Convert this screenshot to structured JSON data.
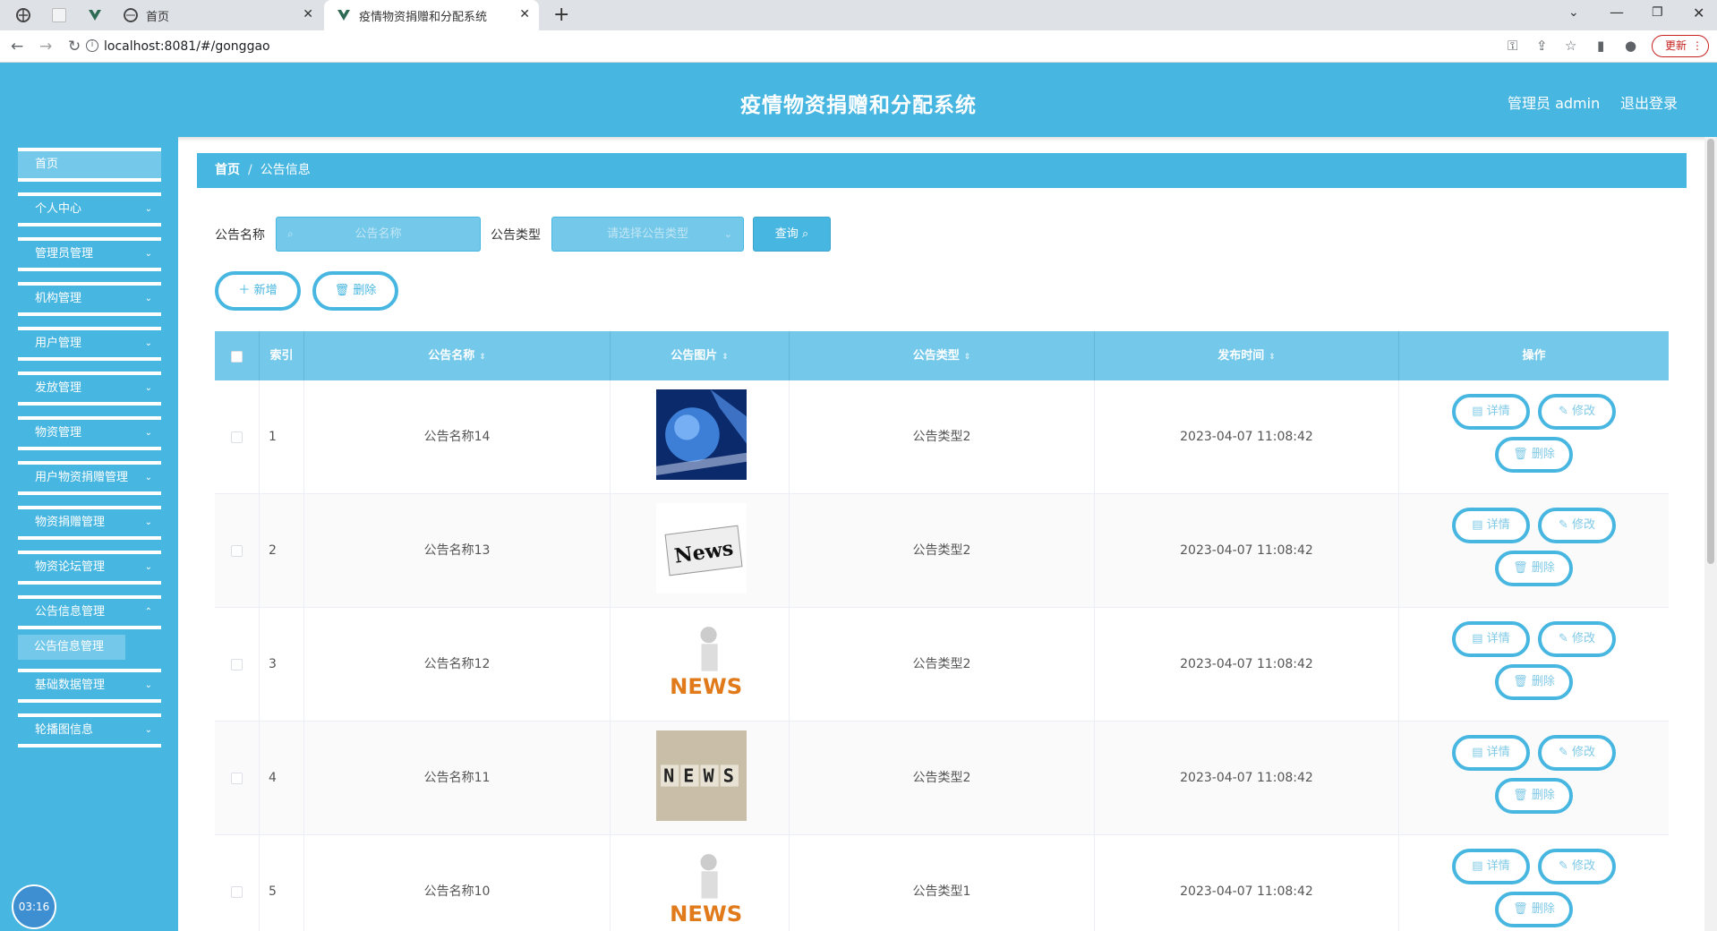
{
  "browser": {
    "tabs": [
      {
        "title": "首页"
      },
      {
        "title": "疫情物资捐赠和分配系统"
      }
    ],
    "new_tab": "+",
    "url": "localhost:8081/#/gonggao",
    "update_label": "更新"
  },
  "app": {
    "title": "疫情物资捐赠和分配系统",
    "user": "管理员 admin",
    "logout": "退出登录"
  },
  "sidebar": {
    "items": [
      {
        "label": "首页"
      },
      {
        "label": "个人中心"
      },
      {
        "label": "管理员管理"
      },
      {
        "label": "机构管理"
      },
      {
        "label": "用户管理"
      },
      {
        "label": "发放管理"
      },
      {
        "label": "物资管理"
      },
      {
        "label": "用户物资捐赠管理"
      },
      {
        "label": "物资捐赠管理"
      },
      {
        "label": "物资论坛管理"
      },
      {
        "label": "公告信息管理"
      },
      {
        "label": "基础数据管理"
      },
      {
        "label": "轮播图信息"
      }
    ],
    "submenu": "公告信息管理",
    "clock": "03:16"
  },
  "breadcrumb": {
    "home": "首页",
    "sep": "/",
    "current": "公告信息"
  },
  "search": {
    "name_label": "公告名称",
    "name_placeholder": "公告名称",
    "type_label": "公告类型",
    "type_placeholder": "请选择公告类型",
    "query_label": "查询"
  },
  "actions": {
    "add": "新增",
    "delete": "删除"
  },
  "table": {
    "headers": [
      "索引",
      "公告名称",
      "公告图片",
      "公告类型",
      "发布时间",
      "操作"
    ],
    "rows": [
      {
        "index": "1",
        "name": "公告名称14",
        "image": "globe-image",
        "type": "公告类型2",
        "time": "2023-04-07 11:08:42"
      },
      {
        "index": "2",
        "name": "公告名称13",
        "image": "news-paper-image",
        "type": "公告类型2",
        "time": "2023-04-07 11:08:42"
      },
      {
        "index": "3",
        "name": "公告名称12",
        "image": "news-figure-image",
        "type": "公告类型2",
        "time": "2023-04-07 11:08:42"
      },
      {
        "index": "4",
        "name": "公告名称11",
        "image": "news-blocks-image",
        "type": "公告类型2",
        "time": "2023-04-07 11:08:42"
      },
      {
        "index": "5",
        "name": "公告名称10",
        "image": "news-figure-image",
        "type": "公告类型1",
        "time": "2023-04-07 11:08:42"
      }
    ],
    "op_labels": {
      "detail": "详情",
      "edit": "修改",
      "delete": "删除"
    }
  },
  "colors": {
    "primary": "#47b6e0",
    "light": "#74c9ea"
  }
}
